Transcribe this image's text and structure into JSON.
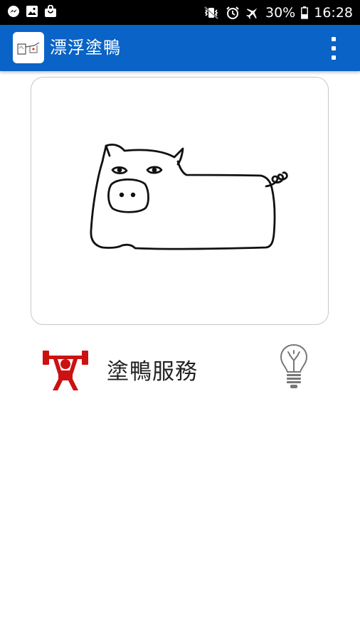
{
  "status_bar": {
    "battery_percent": "30%",
    "time": "16:28",
    "left_icons": [
      "messenger-icon",
      "gallery-icon",
      "shopping-bag-icon"
    ],
    "right_icons": [
      "vibrate-mute-icon",
      "alarm-icon",
      "airplane-mode-icon",
      "battery-icon"
    ]
  },
  "app_bar": {
    "title": "漂浮塗鴨",
    "background_color": "#0a63c6",
    "logo_icon": "app-logo-icon",
    "menu_icon": "overflow-menu-icon"
  },
  "drawing_card": {
    "content_icon": "pig-doodle"
  },
  "service": {
    "label": "塗鴨服務",
    "left_icon": "weightlifter-icon",
    "right_icon": "lightbulb-icon",
    "accent_color": "#cc1111"
  }
}
